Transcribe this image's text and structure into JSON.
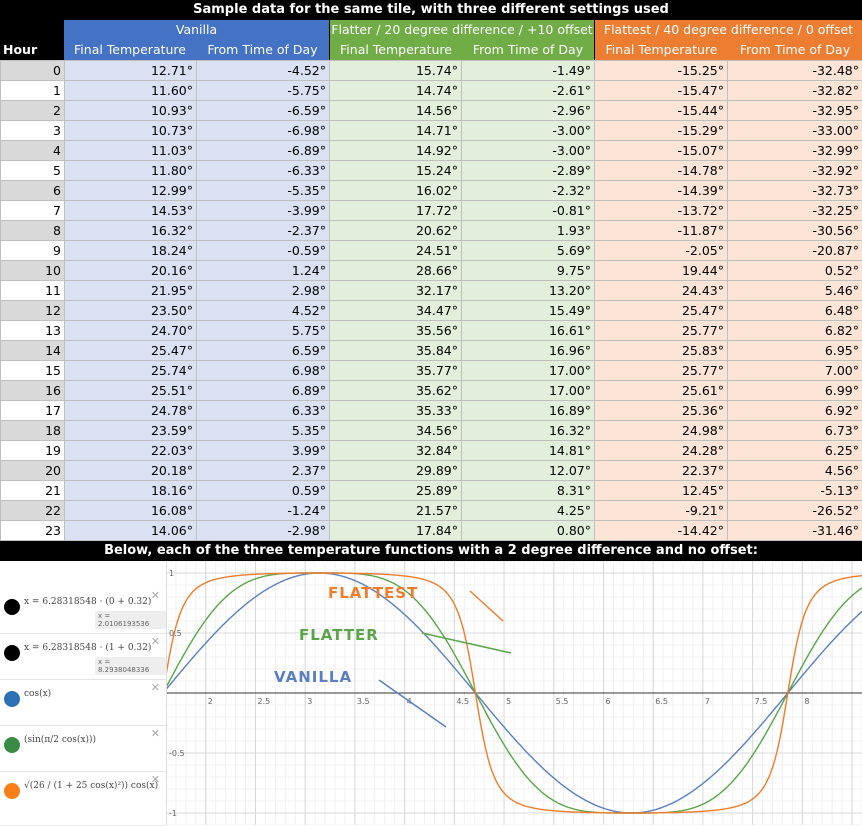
{
  "title": "Sample data for the same tile, with three different settings used",
  "groups": [
    {
      "label": "Vanilla",
      "color": "#4472c4"
    },
    {
      "label": "Flatter / 20 degree difference / +10 offset",
      "color": "#70ad47"
    },
    {
      "label": "Flattest / 40 degree difference / 0 offset",
      "color": "#ed7d31"
    }
  ],
  "columns": {
    "hour": "Hour",
    "final": "Final Temperature",
    "tod": "From Time of Day"
  },
  "rows": [
    [
      "0",
      "12.71°",
      "-4.52°",
      "15.74°",
      "-1.49°",
      "-15.25°",
      "-32.48°"
    ],
    [
      "1",
      "11.60°",
      "-5.75°",
      "14.74°",
      "-2.61°",
      "-15.47°",
      "-32.82°"
    ],
    [
      "2",
      "10.93°",
      "-6.59°",
      "14.56°",
      "-2.96°",
      "-15.44°",
      "-32.95°"
    ],
    [
      "3",
      "10.73°",
      "-6.98°",
      "14.71°",
      "-3.00°",
      "-15.29°",
      "-33.00°"
    ],
    [
      "4",
      "11.03°",
      "-6.89°",
      "14.92°",
      "-3.00°",
      "-15.07°",
      "-32.99°"
    ],
    [
      "5",
      "11.80°",
      "-6.33°",
      "15.24°",
      "-2.89°",
      "-14.78°",
      "-32.92°"
    ],
    [
      "6",
      "12.99°",
      "-5.35°",
      "16.02°",
      "-2.32°",
      "-14.39°",
      "-32.73°"
    ],
    [
      "7",
      "14.53°",
      "-3.99°",
      "17.72°",
      "-0.81°",
      "-13.72°",
      "-32.25°"
    ],
    [
      "8",
      "16.32°",
      "-2.37°",
      "20.62°",
      "1.93°",
      "-11.87°",
      "-30.56°"
    ],
    [
      "9",
      "18.24°",
      "-0.59°",
      "24.51°",
      "5.69°",
      "-2.05°",
      "-20.87°"
    ],
    [
      "10",
      "20.16°",
      "1.24°",
      "28.66°",
      "9.75°",
      "19.44°",
      "0.52°"
    ],
    [
      "11",
      "21.95°",
      "2.98°",
      "32.17°",
      "13.20°",
      "24.43°",
      "5.46°"
    ],
    [
      "12",
      "23.50°",
      "4.52°",
      "34.47°",
      "15.49°",
      "25.47°",
      "6.48°"
    ],
    [
      "13",
      "24.70°",
      "5.75°",
      "35.56°",
      "16.61°",
      "25.77°",
      "6.82°"
    ],
    [
      "14",
      "25.47°",
      "6.59°",
      "35.84°",
      "16.96°",
      "25.83°",
      "6.95°"
    ],
    [
      "15",
      "25.74°",
      "6.98°",
      "35.77°",
      "17.00°",
      "25.77°",
      "7.00°"
    ],
    [
      "16",
      "25.51°",
      "6.89°",
      "35.62°",
      "17.00°",
      "25.61°",
      "6.99°"
    ],
    [
      "17",
      "24.78°",
      "6.33°",
      "35.33°",
      "16.89°",
      "25.36°",
      "6.92°"
    ],
    [
      "18",
      "23.59°",
      "5.35°",
      "34.56°",
      "16.32°",
      "24.98°",
      "6.73°"
    ],
    [
      "19",
      "22.03°",
      "3.99°",
      "32.84°",
      "14.81°",
      "24.28°",
      "6.25°"
    ],
    [
      "20",
      "20.18°",
      "2.37°",
      "29.89°",
      "12.07°",
      "22.37°",
      "4.56°"
    ],
    [
      "21",
      "18.16°",
      "0.59°",
      "25.89°",
      "8.31°",
      "12.45°",
      "-5.13°"
    ],
    [
      "22",
      "16.08°",
      "-1.24°",
      "21.57°",
      "4.25°",
      "-9.21°",
      "-26.52°"
    ],
    [
      "23",
      "14.06°",
      "-2.98°",
      "17.84°",
      "0.80°",
      "-14.42°",
      "-31.46°"
    ]
  ],
  "bottom_title": "Below, each of the three temperature functions with a 2 degree difference and no offset:",
  "expressions": [
    {
      "text": "x = 6.28318548 · (0 + 0.32)",
      "output": "x = 2.0106193536",
      "color": "#000000"
    },
    {
      "text": "x = 6.28318548 · (1 + 0.32)",
      "output": "x = 8.2938048336",
      "color": "#000000"
    },
    {
      "text": "cos(x)",
      "output": "",
      "color": "#2d70b3"
    },
    {
      "text": "(sin(π/2 cos(x)))",
      "output": "",
      "color": "#388c46"
    },
    {
      "text": "√(26 / (1 + 25 cos(x)²)) cos(x)",
      "output": "",
      "color": "#fa7e19"
    }
  ],
  "chart_data": {
    "type": "line",
    "xlim": [
      1.6,
      8.6
    ],
    "ylim": [
      -1.1,
      1.1
    ],
    "xticks": [
      "2",
      "2.5",
      "3",
      "3.5",
      "4",
      "4.5",
      "5",
      "5.5",
      "6",
      "6.5",
      "7",
      "7.5",
      "8"
    ],
    "yticks": [
      "1",
      "0.5",
      "-0.5",
      "-1"
    ],
    "series": [
      {
        "name": "Vanilla",
        "color": "#5b7fc0"
      },
      {
        "name": "Flatter",
        "color": "#5aa54a"
      },
      {
        "name": "Flattest",
        "color": "#ef7d2b"
      }
    ],
    "annotations": [
      "Flattest",
      "Flatter",
      "Vanilla"
    ]
  }
}
